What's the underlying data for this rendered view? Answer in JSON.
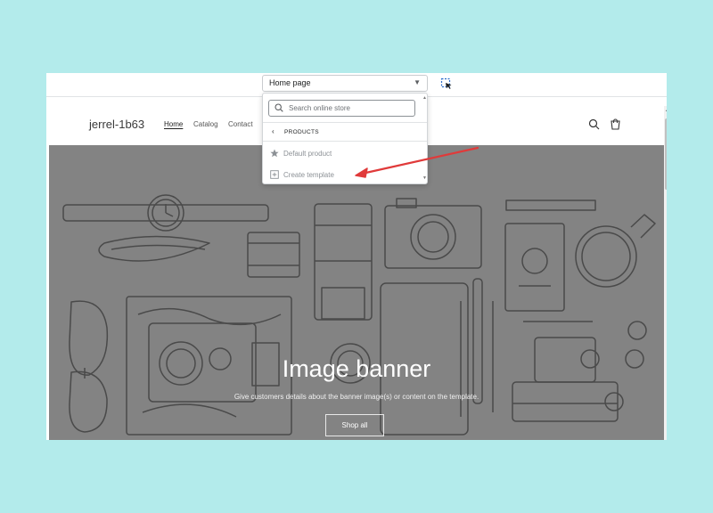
{
  "editor": {
    "page_select": {
      "value": "Home page"
    },
    "dropdown": {
      "search_placeholder": "Search online store",
      "section_label": "PRODUCTS",
      "items": [
        {
          "label": "Default product",
          "icon": "star-icon"
        },
        {
          "label": "Create template",
          "icon": "add-template-icon"
        }
      ]
    }
  },
  "store": {
    "name": "jerrel-1b63",
    "nav": [
      "Home",
      "Catalog",
      "Contact"
    ],
    "icons": [
      "search-icon",
      "cart-icon"
    ]
  },
  "banner": {
    "title": "Image banner",
    "text": "Give customers details about the banner image(s) or content on the template.",
    "button": "Shop all"
  },
  "colors": {
    "background": "#b3ebeb",
    "banner_overlay": "#838383",
    "annotation_arrow": "#e03a3a"
  }
}
